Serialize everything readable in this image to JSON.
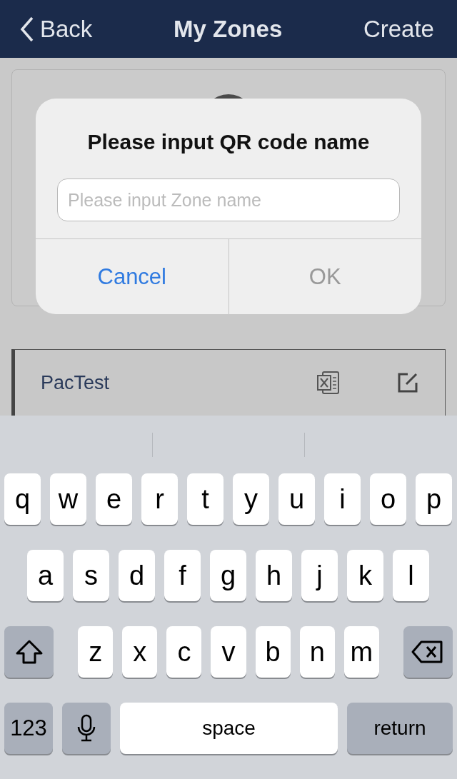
{
  "nav": {
    "back": "Back",
    "title": "My Zones",
    "action": "Create"
  },
  "zones": [
    {
      "kind": "avatar"
    },
    {
      "kind": "row",
      "name": "PacTest"
    }
  ],
  "dialog": {
    "title": "Please input QR code name",
    "placeholder": "Please input Zone name",
    "buttons": [
      {
        "label": "Cancel",
        "disabled": false
      },
      {
        "label": "OK",
        "disabled": true
      }
    ]
  },
  "keyboard": {
    "rows": [
      {
        "keys": [
          {
            "kind": "letter",
            "label": "q"
          },
          {
            "kind": "letter",
            "label": "w"
          },
          {
            "kind": "letter",
            "label": "e"
          },
          {
            "kind": "letter",
            "label": "r"
          },
          {
            "kind": "letter",
            "label": "t"
          },
          {
            "kind": "letter",
            "label": "y"
          },
          {
            "kind": "letter",
            "label": "u"
          },
          {
            "kind": "letter",
            "label": "i"
          },
          {
            "kind": "letter",
            "label": "o"
          },
          {
            "kind": "letter",
            "label": "p"
          }
        ]
      },
      {
        "keys": [
          {
            "kind": "letter",
            "label": "a"
          },
          {
            "kind": "letter",
            "label": "s"
          },
          {
            "kind": "letter",
            "label": "d"
          },
          {
            "kind": "letter",
            "label": "f"
          },
          {
            "kind": "letter",
            "label": "g"
          },
          {
            "kind": "letter",
            "label": "h"
          },
          {
            "kind": "letter",
            "label": "j"
          },
          {
            "kind": "letter",
            "label": "k"
          },
          {
            "kind": "letter",
            "label": "l"
          }
        ]
      },
      {
        "keys": [
          {
            "kind": "shift"
          },
          {
            "kind": "letter",
            "label": "z"
          },
          {
            "kind": "letter",
            "label": "x"
          },
          {
            "kind": "letter",
            "label": "c"
          },
          {
            "kind": "letter",
            "label": "v"
          },
          {
            "kind": "letter",
            "label": "b"
          },
          {
            "kind": "letter",
            "label": "n"
          },
          {
            "kind": "letter",
            "label": "m"
          },
          {
            "kind": "delete"
          }
        ]
      },
      {
        "keys": [
          {
            "kind": "numbers",
            "label": "123"
          },
          {
            "kind": "mic"
          },
          {
            "kind": "space",
            "label": "space"
          },
          {
            "kind": "return",
            "label": "return"
          }
        ]
      }
    ]
  }
}
